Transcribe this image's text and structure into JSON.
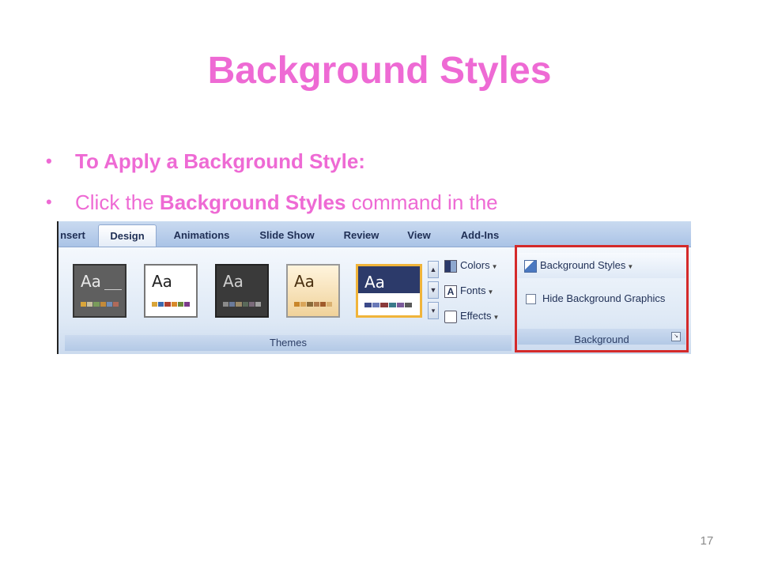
{
  "slide": {
    "title": "Background Styles",
    "bullets": [
      {
        "text": "To Apply a Background Style:"
      },
      {
        "pre": "Click the ",
        "bold": "Background Styles",
        "post": " command in the"
      }
    ],
    "page_number": "17",
    "accent_color": "#ee6ad4"
  },
  "ribbon": {
    "tabs": [
      {
        "label": "nsert",
        "icon": ""
      },
      {
        "label": "Design",
        "active": true
      },
      {
        "label": "Animations"
      },
      {
        "label": "Slide Show"
      },
      {
        "label": "Review"
      },
      {
        "label": "View"
      },
      {
        "label": "Add-Ins"
      }
    ],
    "themes_group": {
      "label": "Themes",
      "thumbnails": [
        {
          "text": "Aa",
          "style": "dark-gray"
        },
        {
          "text": "Aa",
          "style": "white"
        },
        {
          "text": "Aa",
          "style": "charcoal"
        },
        {
          "text": "Aa",
          "style": "tan"
        },
        {
          "text": "Aa",
          "style": "navy-white",
          "selected": true
        }
      ],
      "side_commands": [
        {
          "label": "Colors",
          "icon": "colors-icon"
        },
        {
          "label": "Fonts",
          "icon": "fonts-icon"
        },
        {
          "label": "Effects",
          "icon": "effects-icon"
        }
      ]
    },
    "background_group": {
      "label": "Background",
      "background_styles_label": "Background Styles",
      "hide_graphics_label": "Hide Background Graphics",
      "highlight_color": "#d42a2a"
    }
  }
}
